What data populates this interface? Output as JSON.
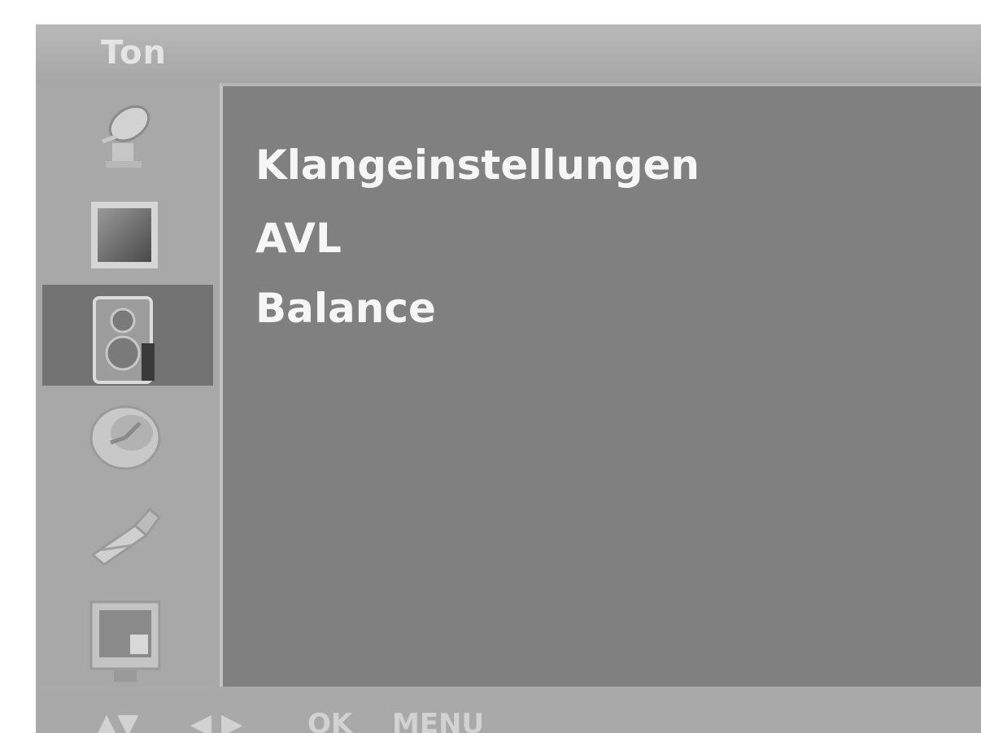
{
  "title_bar": {
    "title": "Ton"
  },
  "sidebar": {
    "items": [
      {
        "icon": "satellite-dish-icon",
        "selected": false
      },
      {
        "icon": "picture-icon",
        "selected": false
      },
      {
        "icon": "speaker-icon",
        "selected": true
      },
      {
        "icon": "clock-icon",
        "selected": false
      },
      {
        "icon": "tools-icon",
        "selected": false
      },
      {
        "icon": "screen-icon",
        "selected": false
      }
    ]
  },
  "menu": {
    "items": [
      {
        "label": "Klangeinstellungen"
      },
      {
        "label": "AVL"
      },
      {
        "label": "Balance"
      }
    ]
  },
  "footer": {
    "nav_updown": "▲▼",
    "nav_leftright": "◀ ▶",
    "ok": "OK",
    "menu": "MENU"
  },
  "colors": {
    "panel_background": "#808080",
    "frame_background": "#a9a9a9",
    "selected_item": "#727272",
    "menu_text": "#f6f6f6"
  }
}
